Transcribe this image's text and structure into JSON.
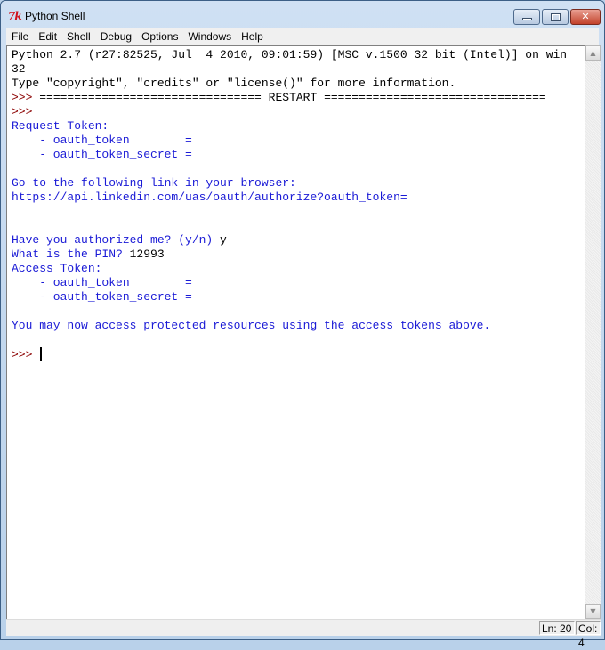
{
  "window": {
    "title": "Python Shell",
    "icon": "tk-icon",
    "controls": {
      "minimize": "minimize",
      "maximize": "maximize",
      "close": "✕"
    }
  },
  "menu": {
    "items": [
      "File",
      "Edit",
      "Shell",
      "Debug",
      "Options",
      "Windows",
      "Help"
    ]
  },
  "shell": {
    "lines": [
      {
        "type": "std",
        "text": "Python 2.7 (r27:82525, Jul  4 2010, 09:01:59) [MSC v.1500 32 bit (Intel)] on win"
      },
      {
        "type": "std",
        "text": "32"
      },
      {
        "type": "std",
        "text": "Type \"copyright\", \"credits\" or \"license()\" for more information."
      },
      {
        "type": "prompt-restart",
        "prompt": ">>> ",
        "text": "================================ RESTART ================================"
      },
      {
        "type": "prompt",
        "prompt": ">>>",
        "text": ""
      },
      {
        "type": "out",
        "text": "Request Token:"
      },
      {
        "type": "out",
        "text": "    - oauth_token        ="
      },
      {
        "type": "out",
        "text": "    - oauth_token_secret ="
      },
      {
        "type": "out",
        "text": ""
      },
      {
        "type": "out",
        "text": "Go to the following link in your browser:"
      },
      {
        "type": "out",
        "text": "https://api.linkedin.com/uas/oauth/authorize?oauth_token="
      },
      {
        "type": "out",
        "text": ""
      },
      {
        "type": "out",
        "text": ""
      },
      {
        "type": "input",
        "text": "Have you authorized me? (y/n) ",
        "input": "y"
      },
      {
        "type": "input",
        "text": "What is the PIN? ",
        "input": "12993"
      },
      {
        "type": "out",
        "text": "Access Token:"
      },
      {
        "type": "out",
        "text": "    - oauth_token        ="
      },
      {
        "type": "out",
        "text": "    - oauth_token_secret ="
      },
      {
        "type": "out",
        "text": ""
      },
      {
        "type": "out",
        "text": "You may now access protected resources using the access tokens above."
      },
      {
        "type": "out",
        "text": ""
      },
      {
        "type": "current-prompt",
        "prompt": ">>> ",
        "text": ""
      }
    ]
  },
  "status": {
    "line": "Ln: 20",
    "col": "Col: 4"
  },
  "colors": {
    "stdout": "#1a1ad6",
    "prompt": "#8b0000",
    "stdin": "#000000"
  }
}
